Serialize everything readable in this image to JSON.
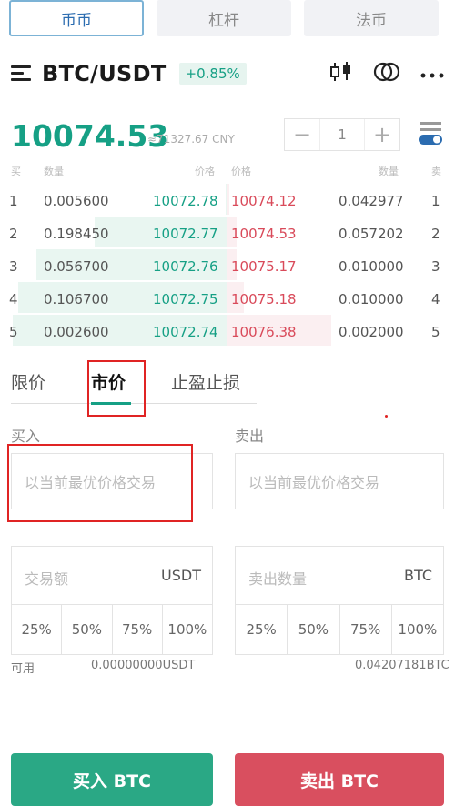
{
  "top_tabs": [
    {
      "label": "币币"
    },
    {
      "label": "杠杆"
    },
    {
      "label": "法币"
    }
  ],
  "header": {
    "pair": "BTC/USDT",
    "change": "+0.85%",
    "icons": [
      "menu-icon",
      "candlestick-chart-icon",
      "swap-circles-icon",
      "more-icon"
    ]
  },
  "price": {
    "last": "10074.53",
    "cny": "≈71327.67 CNY"
  },
  "stepper": {
    "minus": "−",
    "value": "1",
    "plus": "+"
  },
  "order_book": {
    "headers": {
      "buy": "买",
      "qty_left": "数量",
      "price_left": "价格",
      "price_right": "价格",
      "qty_right": "数量",
      "sell": "卖"
    },
    "rows": [
      {
        "idx": "1",
        "bid_qty": "0.005600",
        "bid_price": "10072.78",
        "ask_price": "10074.12",
        "ask_qty": "0.042977",
        "ask_idx": "1"
      },
      {
        "idx": "2",
        "bid_qty": "0.198450",
        "bid_price": "10072.77",
        "ask_price": "10074.53",
        "ask_qty": "0.057202",
        "ask_idx": "2"
      },
      {
        "idx": "3",
        "bid_qty": "0.056700",
        "bid_price": "10072.76",
        "ask_price": "10075.17",
        "ask_qty": "0.010000",
        "ask_idx": "3"
      },
      {
        "idx": "4",
        "bid_qty": "0.106700",
        "bid_price": "10072.75",
        "ask_price": "10075.18",
        "ask_qty": "0.010000",
        "ask_idx": "4"
      },
      {
        "idx": "5",
        "bid_qty": "0.002600",
        "bid_price": "10072.74",
        "ask_price": "10076.38",
        "ask_qty": "0.002000",
        "ask_idx": "5"
      }
    ]
  },
  "order_tabs": [
    {
      "label": "限价"
    },
    {
      "label": "市价"
    },
    {
      "label": "止盈止损"
    }
  ],
  "buy": {
    "label": "买入",
    "price_placeholder": "以当前最优价格交易",
    "amount_placeholder": "交易额",
    "unit": "USDT",
    "percents": [
      "25%",
      "50%",
      "75%",
      "100%"
    ],
    "avail_label": "可用",
    "avail_value": "0.00000000USDT",
    "button": "买入 BTC"
  },
  "sell": {
    "label": "卖出",
    "price_placeholder": "以当前最优价格交易",
    "amount_placeholder": "卖出数量",
    "unit": "BTC",
    "percents": [
      "25%",
      "50%",
      "75%",
      "100%"
    ],
    "avail_value": "0.04207181BTC",
    "button": "卖出 BTC"
  },
  "colors": {
    "green": "#16a085",
    "red": "#d94a5a",
    "buy_button": "#2aa885",
    "sell_button": "#d94f5f",
    "highlight": "#e02424"
  }
}
